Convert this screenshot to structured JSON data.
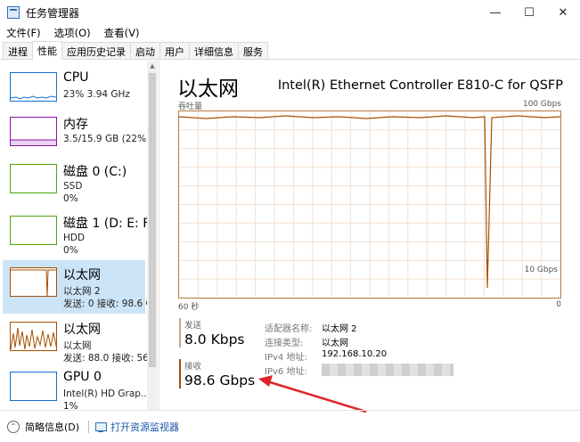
{
  "window": {
    "title": "任务管理器",
    "minimize": "—",
    "maximize": "☐",
    "close": "✕"
  },
  "menu": [
    "文件(F)",
    "选项(O)",
    "查看(V)"
  ],
  "tabs": [
    "进程",
    "性能",
    "应用历史记录",
    "启动",
    "用户",
    "详细信息",
    "服务"
  ],
  "active_tab_index": 1,
  "sidebar": [
    {
      "name": "CPU",
      "line2": "23% 3.94 GHz",
      "line3": "",
      "color": "#1170cf"
    },
    {
      "name": "内存",
      "line2": "3.5/15.9 GB (22%)",
      "line3": "",
      "color": "#8b12ae"
    },
    {
      "name": "磁盘 0 (C:)",
      "line2": "SSD",
      "line3": "0%",
      "color": "#4da60c"
    },
    {
      "name": "磁盘 1 (D: E: F:",
      "line2": "HDD",
      "line3": "0%",
      "color": "#4da60c"
    },
    {
      "name": "以太网",
      "line2": "以太网 2",
      "line3": "发送: 0 接收: 98.6 G",
      "color": "#a74f01",
      "selected": true
    },
    {
      "name": "以太网",
      "line2": "以太网",
      "line3": "发送: 88.0 接收: 56.",
      "color": "#a74f01"
    },
    {
      "name": "GPU 0",
      "line2": "Intel(R) HD Grap...",
      "line3": "1%",
      "color": "#1170cf"
    }
  ],
  "main": {
    "title": "以太网",
    "adapter": "Intel(R) Ethernet Controller E810-C for QSFP",
    "graph_label": "吞吐量",
    "graph_max": "100 Gbps",
    "graph_mid": "10 Gbps",
    "axis_left": "60 秒",
    "axis_right": "0",
    "send_label": "发送",
    "send_value": "8.0 Kbps",
    "recv_label": "接收",
    "recv_value": "98.6 Gbps",
    "info": [
      {
        "key": "适配器名称:",
        "value": "以太网 2"
      },
      {
        "key": "连接类型:",
        "value": "以太网"
      },
      {
        "key": "IPv4 地址:",
        "value": "192.168.10.20"
      },
      {
        "key": "IPv6 地址:",
        "value": ""
      }
    ]
  },
  "graph_color": "#a74f01",
  "footer": {
    "fewer": "简略信息(D)",
    "monitor": "打开资源监视器"
  }
}
